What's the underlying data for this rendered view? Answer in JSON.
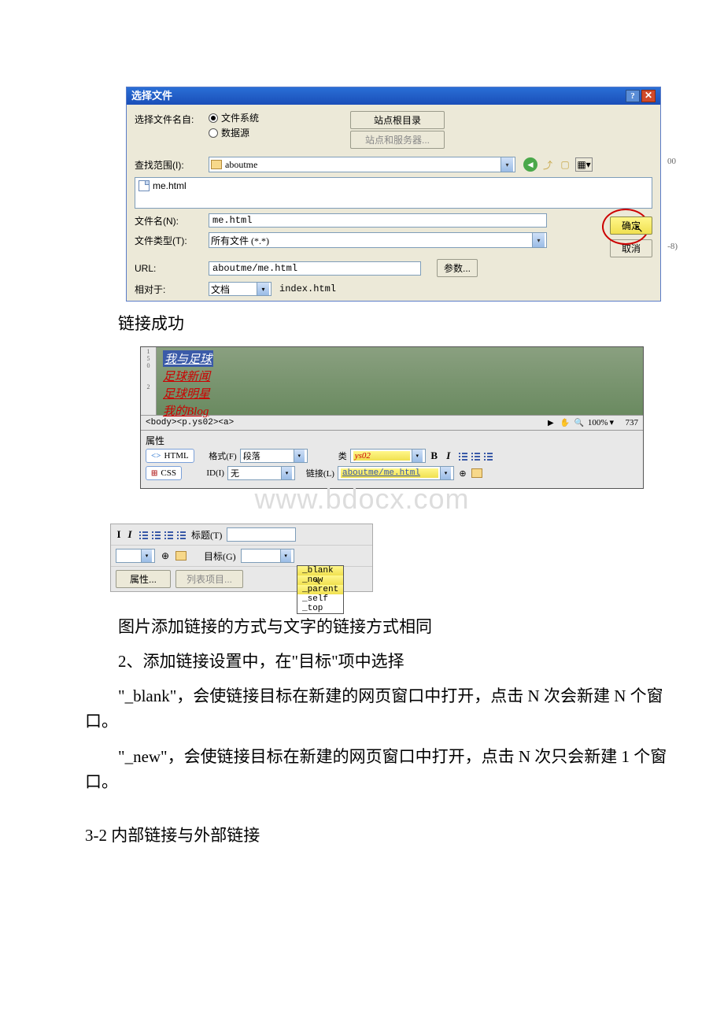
{
  "dialog": {
    "title": "选择文件",
    "row_name_label": "选择文件名自:",
    "radio_fs": "文件系统",
    "radio_ds": "数据源",
    "btn_site_root": "站点根目录",
    "btn_site_server": "站点和服务器...",
    "look_in_label": "查找范围(I):",
    "look_in_value": "aboutme",
    "file_item": "me.html",
    "filename_label": "文件名(N):",
    "filename_value": "me.html",
    "filetype_label": "文件类型(T):",
    "filetype_value": "所有文件 (*.*)",
    "ok": "确定",
    "cancel": "取消",
    "url_label": "URL:",
    "url_value": "aboutme/me.html",
    "param_btn": "参数...",
    "rel_label": "相对于:",
    "rel_value": "文档",
    "rel_file": "index.html",
    "edge1": "00",
    "edge2": "-8)"
  },
  "text": {
    "p1": "链接成功",
    "p2": "图片添加链接的方式与文字的链接方式相同",
    "p3": "2、添加链接设置中，在\"目标\"项中选择",
    "p4": "\"_blank\"，会使链接目标在新建的网页窗口中打开，点击 N 次会新建 N 个窗口。",
    "p5": "\"_new\"，会使链接目标在新建的网页窗口中打开，点击 N 次只会新建 1 个窗口。",
    "p6": "3-2 内部链接与外部链接",
    "watermark": "www.bdocx.com"
  },
  "sc2": {
    "ruler1": "1\n5\n0",
    "ruler2": "2",
    "links": [
      "我与足球",
      "足球新闻",
      "足球明星",
      "我的Blog"
    ],
    "tagpath": "<body><p.ys02><a>",
    "zoom": "100%",
    "size": "737",
    "props_title": "属性",
    "html_label": "HTML",
    "css_label": "CSS",
    "format_label": "格式(F)",
    "format_value": "段落",
    "class_label": "类",
    "class_value": "ys02",
    "id_label": "ID(I)",
    "id_value": "无",
    "link_label": "链接(L)",
    "link_value": "aboutme/me.html"
  },
  "sc3": {
    "title_label": "标题(T)",
    "target_label": "目标(G)",
    "page_props": "属性...",
    "list_items": "列表项目...",
    "opts": [
      "_blank",
      "_new",
      "_parent",
      "_self",
      "_top"
    ]
  }
}
